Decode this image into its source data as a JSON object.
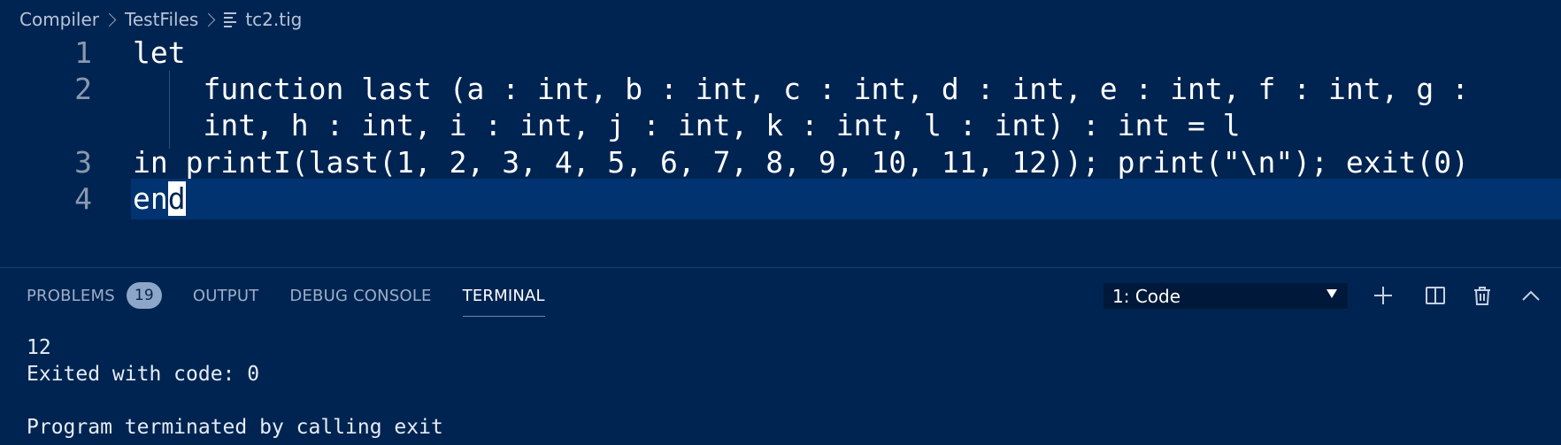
{
  "breadcrumb": {
    "items": [
      "Compiler",
      "TestFiles"
    ],
    "file": "tc2.tig",
    "file_icon": "file-text-icon"
  },
  "editor": {
    "lines": [
      {
        "number": "1",
        "text": "let"
      },
      {
        "number": "2",
        "text": "    function last (a : int, b : int, c : int, d : int, e : int, f : int, g :",
        "wrap": "    int, h : int, i : int, j : int, k : int, l : int) : int = l"
      },
      {
        "number": "3",
        "text": "in printI(last(1, 2, 3, 4, 5, 6, 7, 8, 9, 10, 11, 12)); print(\"\\n\"); exit(0)"
      },
      {
        "number": "4",
        "text_before_cursor": "en",
        "cursor_char": "d"
      }
    ],
    "current_line_color": "#003370",
    "background": "#002451"
  },
  "panel": {
    "tabs": [
      {
        "label": "PROBLEMS",
        "badge": "19"
      },
      {
        "label": "OUTPUT"
      },
      {
        "label": "DEBUG CONSOLE"
      },
      {
        "label": "TERMINAL",
        "active": true
      }
    ],
    "terminal_select": "1: Code",
    "actions": [
      "plus-icon",
      "split-icon",
      "trash-icon",
      "chevron-up-icon"
    ]
  },
  "terminal": {
    "lines": [
      "12",
      "Exited with code: 0",
      "",
      "Program terminated by calling exit"
    ]
  }
}
